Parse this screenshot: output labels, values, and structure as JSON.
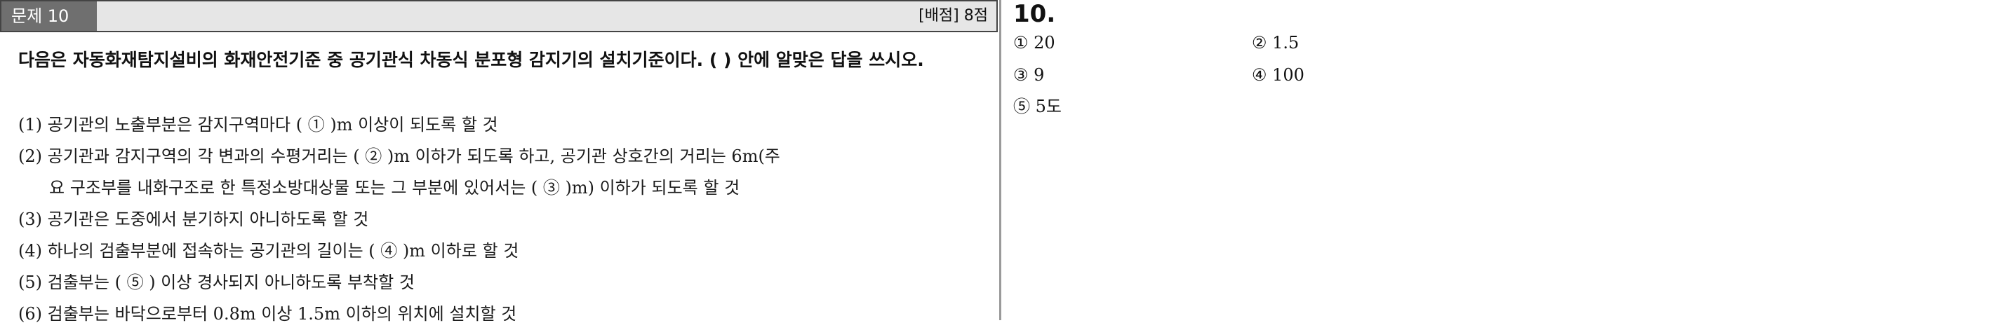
{
  "question": {
    "label": "문제 10",
    "score": "[배점] 8점",
    "prompt": "다음은 자동화재탐지설비의 화재안전기준 중 공기관식 차동식 분포형 감지기의 설치기준이다. (     ) 안에 알맞은 답을 쓰시오.",
    "items": [
      "(1) 공기관의 노출부분은 감지구역마다 (   ①   )m 이상이 되도록 할 것",
      "(2) 공기관과 감지구역의 각 변과의 수평거리는 (   ②   )m 이하가 되도록 하고, 공기관 상호간의 거리는 6m(주",
      "요 구조부를 내화구조로 한 특정소방대상물 또는 그 부분에 있어서는 (   ③   )m) 이하가 되도록 할 것",
      "(3) 공기관은 도중에서 분기하지 아니하도록 할 것",
      "(4) 하나의 검출부분에 접속하는 공기관의 길이는 (   ④   )m 이하로 할 것",
      "(5) 검출부는 (   ⑤   ) 이상 경사되지 아니하도록 부착할 것",
      "(6) 검출부는 바닥으로부터 0.8m 이상 1.5m 이하의 위치에 설치할 것"
    ]
  },
  "answer": {
    "number": "10.",
    "a1": "① 20",
    "a2": "② 1.5",
    "a3": "③ 9",
    "a4": "④ 100",
    "a5": "⑤ 5도"
  }
}
